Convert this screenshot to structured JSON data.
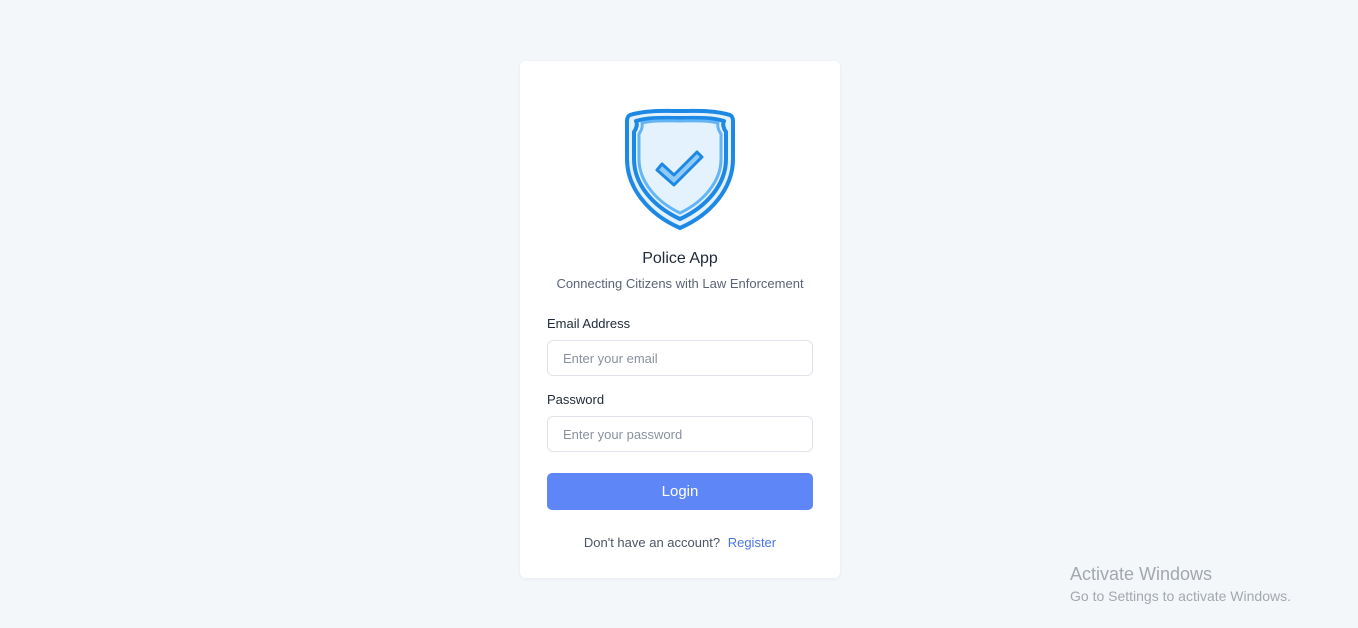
{
  "app": {
    "title": "Police App",
    "subtitle": "Connecting Citizens with Law Enforcement",
    "logo_icon": "shield-check-icon"
  },
  "form": {
    "email_label": "Email Address",
    "email_placeholder": "Enter your email",
    "email_value": "",
    "password_label": "Password",
    "password_placeholder": "Enter your password",
    "password_value": "",
    "login_label": "Login"
  },
  "register": {
    "prompt": "Don't have an account?",
    "link_label": "Register"
  },
  "watermark": {
    "title": "Activate Windows",
    "subtitle": "Go to Settings to activate Windows."
  },
  "colors": {
    "background": "#f4f7fa",
    "accent": "#5f86f7",
    "link": "#4a76e8",
    "shield_outline": "#1e88e5",
    "shield_fill": "#e3f2fd"
  }
}
